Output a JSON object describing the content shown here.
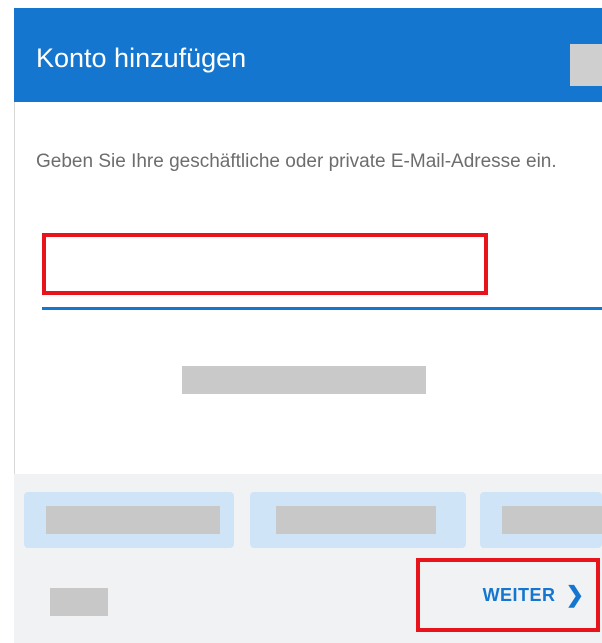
{
  "header": {
    "title": "Konto hinzufügen",
    "action_icon": "menu-placeholder-icon"
  },
  "main": {
    "prompt": "Geben Sie Ihre geschäftliche oder private E-Mail-Adresse ein.",
    "email_value": "",
    "email_placeholder": ""
  },
  "footer": {
    "next_label": "WEITER",
    "next_icon": "chevron-right-icon"
  },
  "colors": {
    "accent": "#1476cf",
    "highlight": "#e8141b",
    "chip_background": "#cfe4f6",
    "footer_background": "#f1f2f4"
  }
}
